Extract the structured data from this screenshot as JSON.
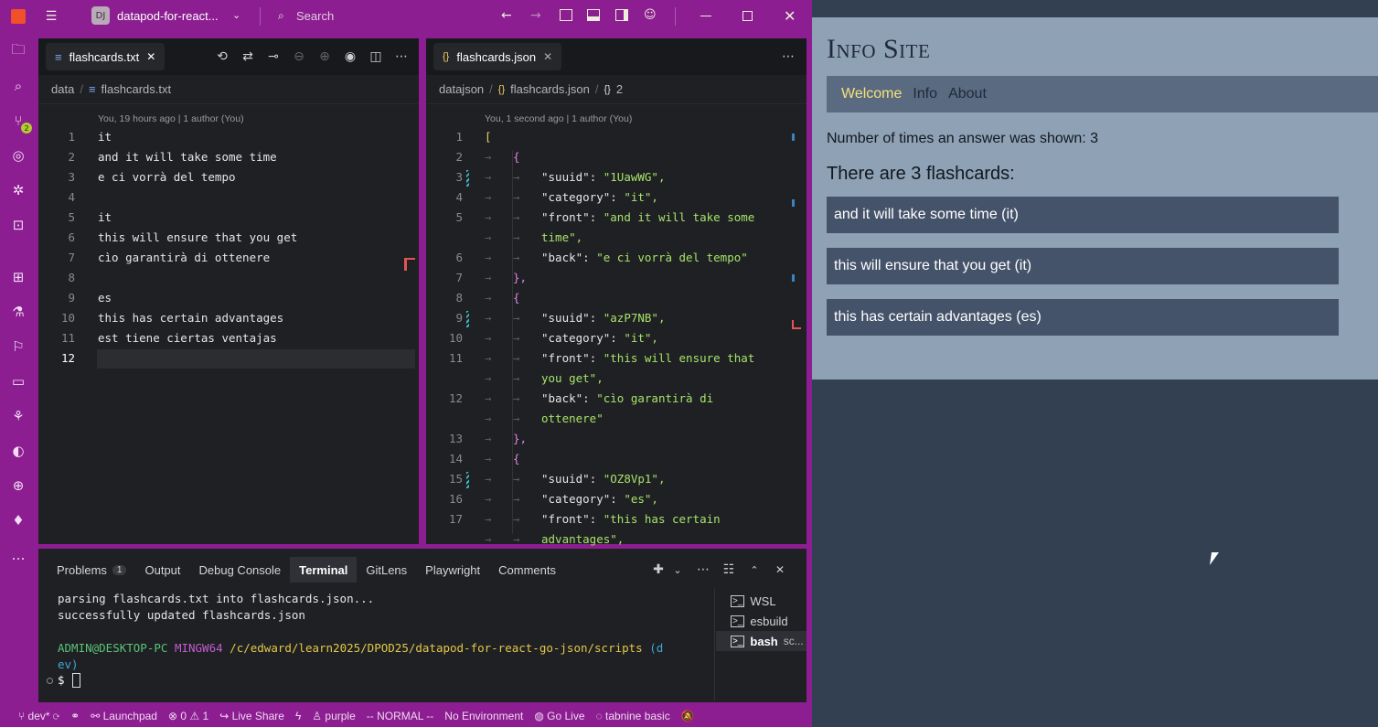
{
  "titlebar": {
    "project_initials": "DJ",
    "project_name": "datapod-for-react...",
    "search_placeholder": "Search"
  },
  "left_editor": {
    "tab_label": "flashcards.txt",
    "breadcrumb": [
      "data",
      "flashcards.txt"
    ],
    "blame": "You, 19 hours ago | 1 author (You)",
    "lines": [
      "it",
      "and it will take some time",
      "e ci vorrà del tempo",
      "",
      "it",
      "this will ensure that you get",
      "cìo garantirà di ottenere",
      "",
      "es",
      "this has certain advantages",
      "est tiene ciertas ventajas",
      ""
    ],
    "line_numbers": [
      "1",
      "2",
      "3",
      "4",
      "5",
      "6",
      "7",
      "8",
      "9",
      "10",
      "11",
      "12"
    ]
  },
  "right_editor": {
    "tab_label": "flashcards.json",
    "breadcrumb": [
      "datajson",
      "flashcards.json",
      "2"
    ],
    "blame": "You, 1 second ago | 1 author (You)",
    "line_numbers": [
      "1",
      "2",
      "3",
      "4",
      "5",
      "",
      "6",
      "7",
      "8",
      "9",
      "10",
      "11",
      "",
      "12",
      "",
      "13",
      "14",
      "15",
      "16",
      "17",
      ""
    ],
    "json_lines": [
      "[",
      "{",
      "\"suuid\": \"1UawWG\",",
      "\"category\": \"it\",",
      "\"front\": \"and it will take some",
      "time\",",
      "\"back\": \"e ci vorrà del tempo\"",
      "},",
      "{",
      "\"suuid\": \"azP7NB\",",
      "\"category\": \"it\",",
      "\"front\": \"this will ensure that",
      "you get\",",
      "\"back\": \"cìo garantirà di",
      "ottenere\"",
      "},",
      "{",
      "\"suuid\": \"OZ8Vp1\",",
      "\"category\": \"es\",",
      "\"front\": \"this has certain",
      "advantages\","
    ]
  },
  "panel": {
    "tabs": [
      "Problems",
      "Output",
      "Debug Console",
      "Terminal",
      "GitLens",
      "Playwright",
      "Comments"
    ],
    "problems_count": "1",
    "active_tab": "Terminal",
    "terminal_lines": [
      "parsing flashcards.txt into flashcards.json...",
      "successfully updated flashcards.json"
    ],
    "prompt_user": "ADMIN@DESKTOP-PC",
    "prompt_env": "MINGW64",
    "prompt_path": "/c/edward/learn2025/DPOD25/datapod-for-react-go-json/scripts",
    "prompt_branch_a": "(d",
    "prompt_branch_b": "ev)",
    "prompt_symbol": "$",
    "terminals": [
      "WSL",
      "esbuild",
      "bash",
      "sc..."
    ]
  },
  "statusbar": {
    "branch": "dev*",
    "launchpad": "Launchpad",
    "errors": "0",
    "warnings": "1",
    "live_share": "Live Share",
    "theme": "purple",
    "mode": "-- NORMAL --",
    "environment": "No Environment",
    "go_live": "Go Live",
    "tabnine": "tabnine basic"
  },
  "site": {
    "title": "Info Site",
    "nav": [
      "Welcome",
      "Info",
      "About"
    ],
    "shown_text": "Number of times an answer was shown: 3",
    "count_heading": "There are 3 flashcards:",
    "cards": [
      "and it will take some time (it)",
      "this will ensure that you get (it)",
      "this has certain advantages (es)"
    ]
  },
  "colors": {
    "frame": "#8c1e91",
    "editor_bg": "#1f2023",
    "site_bg": "#8fa1b4",
    "nav_active": "#f4e27a",
    "card_bg": "#45536a"
  }
}
